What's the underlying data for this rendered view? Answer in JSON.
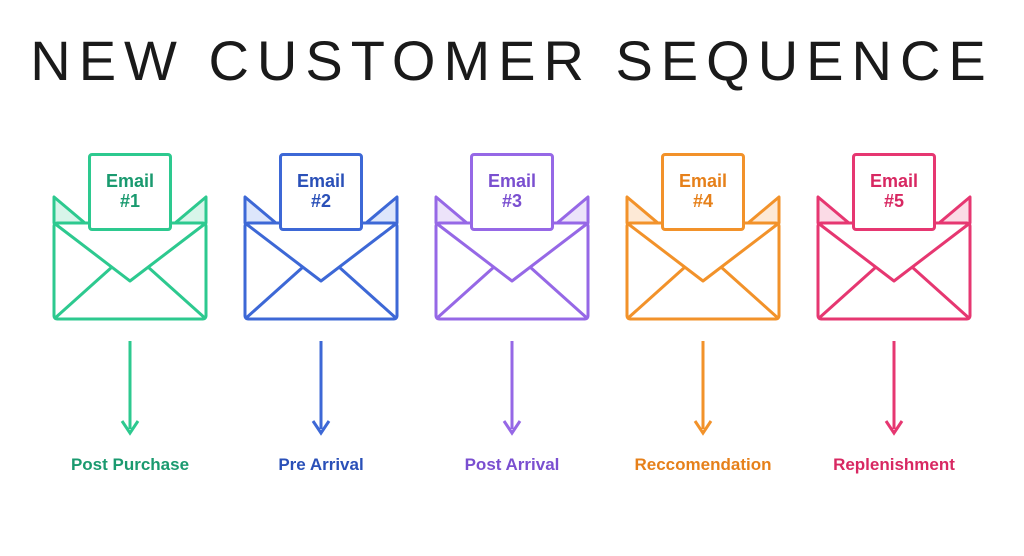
{
  "title": "NEW CUSTOMER SEQUENCE",
  "steps": [
    {
      "label": "Email",
      "number": "#1",
      "caption": "Post Purchase",
      "stroke": "#2dc98f",
      "text": "#1a9a6f",
      "fill": "#d8f5ea"
    },
    {
      "label": "Email",
      "number": "#2",
      "caption": "Pre Arrival",
      "stroke": "#3d68d6",
      "text": "#2a50b8",
      "fill": "#dde6fb"
    },
    {
      "label": "Email",
      "number": "#3",
      "caption": "Post Arrival",
      "stroke": "#9668e6",
      "text": "#7a4fd0",
      "fill": "#ece3fa"
    },
    {
      "label": "Email",
      "number": "#4",
      "caption": "Reccomendation",
      "stroke": "#f2922a",
      "text": "#e6801a",
      "fill": "#fde9d6"
    },
    {
      "label": "Email",
      "number": "#5",
      "caption": "Replenishment",
      "stroke": "#e63771",
      "text": "#d82862",
      "fill": "#fbdbe6"
    }
  ]
}
